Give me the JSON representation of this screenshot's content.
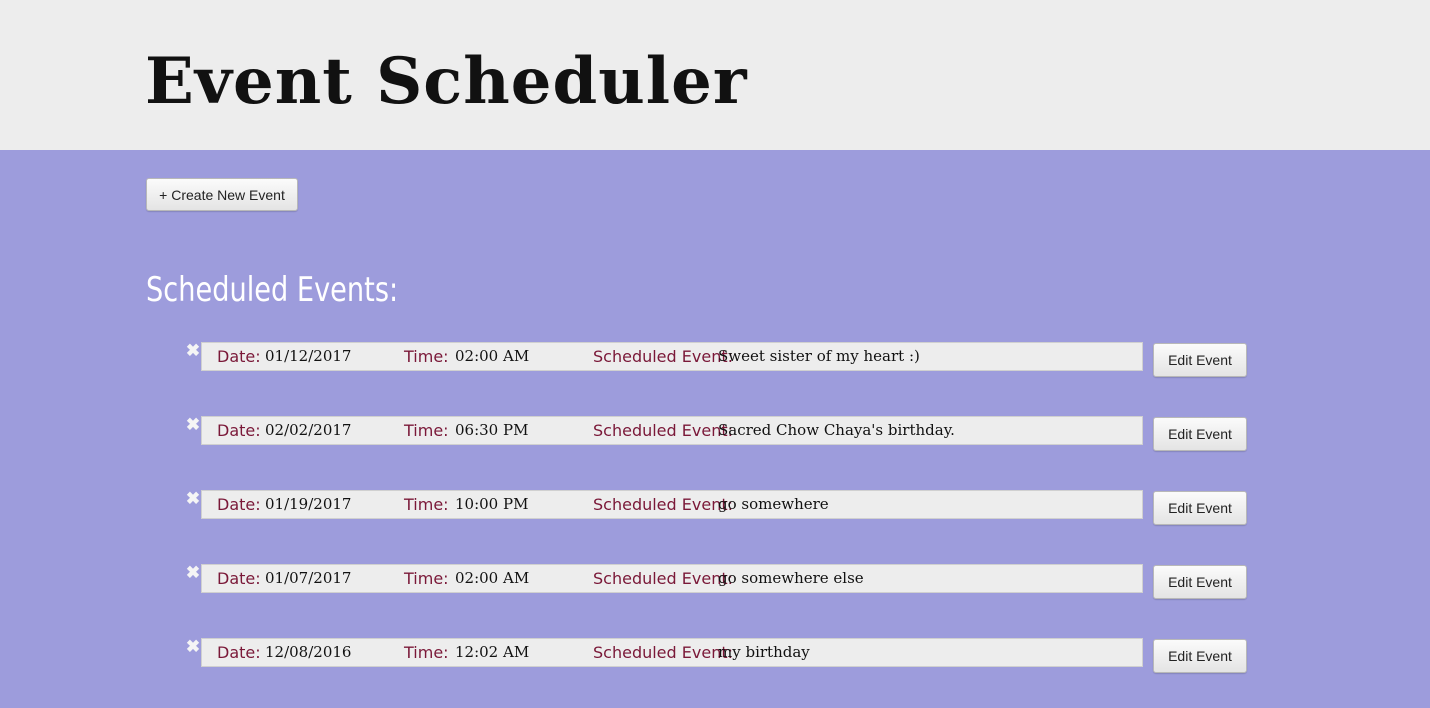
{
  "header": {
    "title": "Event Scheduler"
  },
  "toolbar": {
    "create_label": "+ Create New Event"
  },
  "events_section": {
    "title": "Scheduled Events:",
    "labels": {
      "date": "Date:",
      "time": "Time:",
      "event": "Scheduled Event:"
    },
    "delete_glyph": "✖",
    "edit_label": "Edit Event"
  },
  "events": [
    {
      "date": "01/12/2017",
      "time": "02:00 AM",
      "event": "Sweet sister of my heart :)"
    },
    {
      "date": "02/02/2017",
      "time": "06:30 PM",
      "event": "Sacred Chow Chaya's birthday."
    },
    {
      "date": "01/19/2017",
      "time": "10:00 PM",
      "event": "go somewhere"
    },
    {
      "date": "01/07/2017",
      "time": "02:00 AM",
      "event": "go somewhere else"
    },
    {
      "date": "12/08/2016",
      "time": "12:02 AM",
      "event": "my birthday"
    }
  ],
  "colors": {
    "header_bg": "#ededed",
    "main_bg": "#9d9cdc",
    "label_color": "#7a1838",
    "row_bg": "#ededed"
  },
  "icons": {
    "delete": "close-icon"
  }
}
